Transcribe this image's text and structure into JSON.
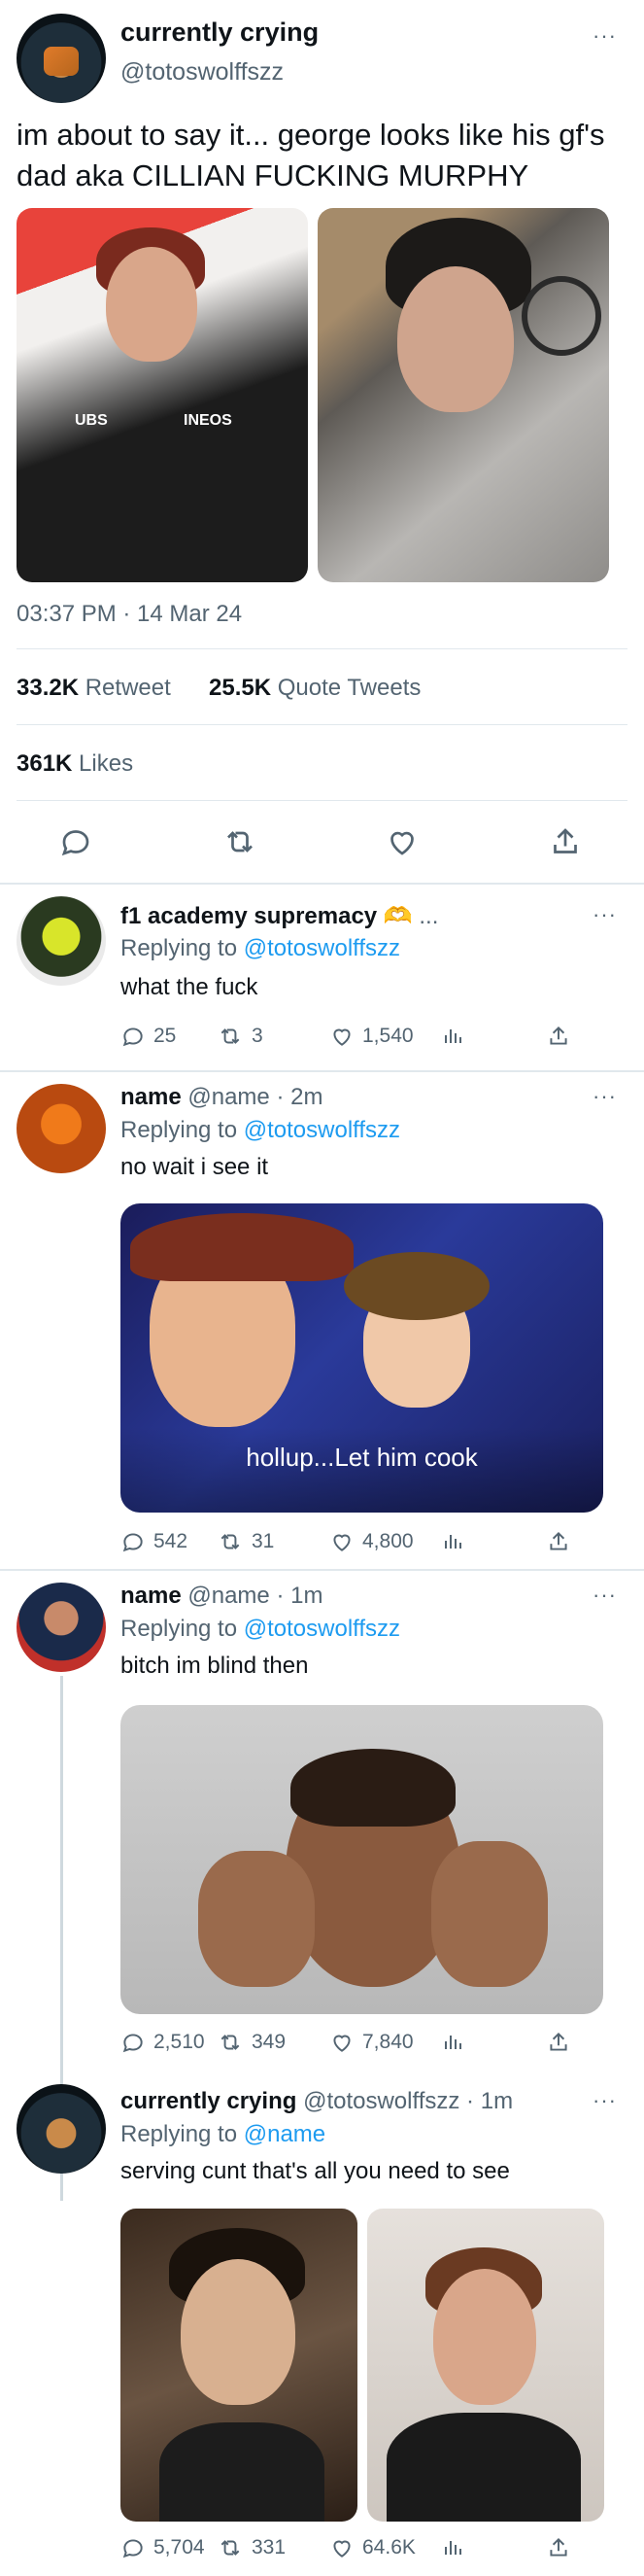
{
  "main_tweet": {
    "display_name": "currently crying",
    "handle": "@totoswolffszz",
    "text": "im about to say it... george looks like his gf's dad aka CILLIAN FUCKING MURPHY",
    "timestamp": "03:37 PM · 14 Mar 24",
    "retweets": {
      "count": "33.2K",
      "label": "Retweet"
    },
    "quotes": {
      "count": "25.5K",
      "label": "Quote Tweets"
    },
    "likes": {
      "count": "361K",
      "label": "Likes"
    },
    "more": "···"
  },
  "replies": [
    {
      "display_name": "f1 academy supremacy 🫶",
      "trailing": "...",
      "meta": "",
      "replying_prefix": "Replying to",
      "replying_to": "@totoswolffszz",
      "text": "what the fuck",
      "comments": "25",
      "retweets": "3",
      "likes": "1,540"
    },
    {
      "display_name": "name",
      "meta": "@name · 2m",
      "replying_prefix": "Replying to",
      "replying_to": "@totoswolffszz",
      "text": "no wait i see it",
      "media_caption": "hollup...Let him cook",
      "comments": "542",
      "retweets": "31",
      "likes": "4,800"
    },
    {
      "display_name": "name",
      "meta": "@name · 1m",
      "replying_prefix": "Replying to",
      "replying_to": "@totoswolffszz",
      "text": "bitch im blind then",
      "comments": "2,510",
      "retweets": "349",
      "likes": "7,840"
    },
    {
      "display_name": "currently crying",
      "meta": "@totoswolffszz · 1m",
      "replying_prefix": "Replying to",
      "replying_to": "@name",
      "text": "serving cunt that's all you need to see",
      "comments": "5,704",
      "retweets": "331",
      "likes": "64.6K"
    }
  ],
  "colors": {
    "accent": "#1d9bf0",
    "muted": "#536471",
    "divider": "#e1e8ed"
  },
  "icons": [
    "reply-icon",
    "retweet-icon",
    "like-icon",
    "share-icon",
    "analytics-icon",
    "more-icon"
  ]
}
